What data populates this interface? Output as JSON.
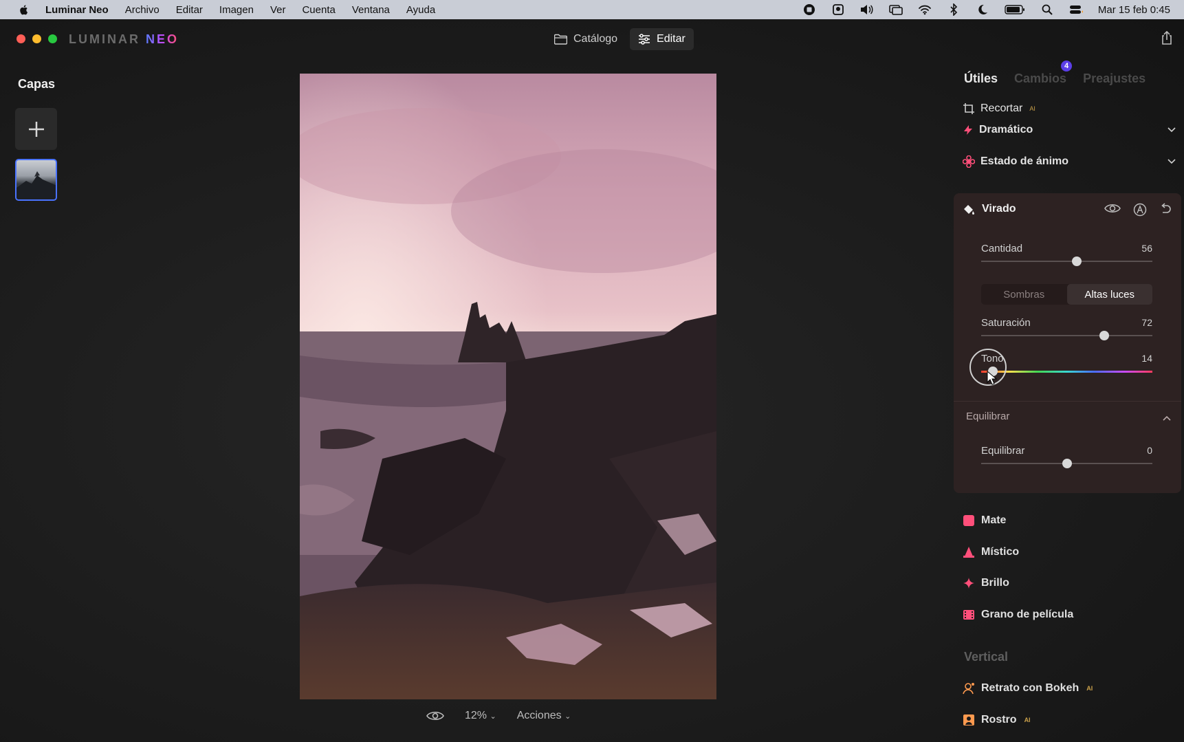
{
  "menubar": {
    "app_name": "Luminar Neo",
    "items": [
      "Archivo",
      "Editar",
      "Imagen",
      "Ver",
      "Cuenta",
      "Ventana",
      "Ayuda"
    ],
    "clock": "Mar 15 feb  0:45"
  },
  "app": {
    "logo_left": "LUMINAR",
    "logo_right": "NEO",
    "nav": {
      "catalog": "Catálogo",
      "edit": "Editar"
    }
  },
  "layers": {
    "title": "Capas"
  },
  "bottom": {
    "zoom": "12%",
    "actions": "Acciones"
  },
  "panel": {
    "tabs": {
      "useful": "Útiles",
      "changes": "Cambios",
      "changes_badge": "4",
      "presets": "Preajustes"
    },
    "crop": "Recortar",
    "crop_tag": "AI",
    "dramatic": "Dramático",
    "mood": "Estado de ánimo",
    "toning": {
      "title": "Virado",
      "amount_label": "Cantidad",
      "amount_value": "56",
      "amount_fraction": 0.56,
      "seg_shadows": "Sombras",
      "seg_highlights": "Altas luces",
      "saturation_label": "Saturación",
      "saturation_value": "72",
      "saturation_fraction": 0.72,
      "hue_label": "Tono",
      "hue_value": "14",
      "hue_fraction": 0.07,
      "balance_section": "Equilibrar",
      "balance_label": "Equilibrar",
      "balance_value": "0",
      "balance_fraction": 0.5
    },
    "matte": "Mate",
    "mystic": "Místico",
    "glow": "Brillo",
    "film_grain": "Grano de película",
    "vertical_title": "Vertical",
    "bokeh": "Retrato con Bokeh",
    "bokeh_tag": "AI",
    "face": "Rostro",
    "face_tag": "AI"
  },
  "colors": {
    "accent": "#4a73ff",
    "tool_icon": "#ff4f7a",
    "badge": "#5b3ee8"
  }
}
